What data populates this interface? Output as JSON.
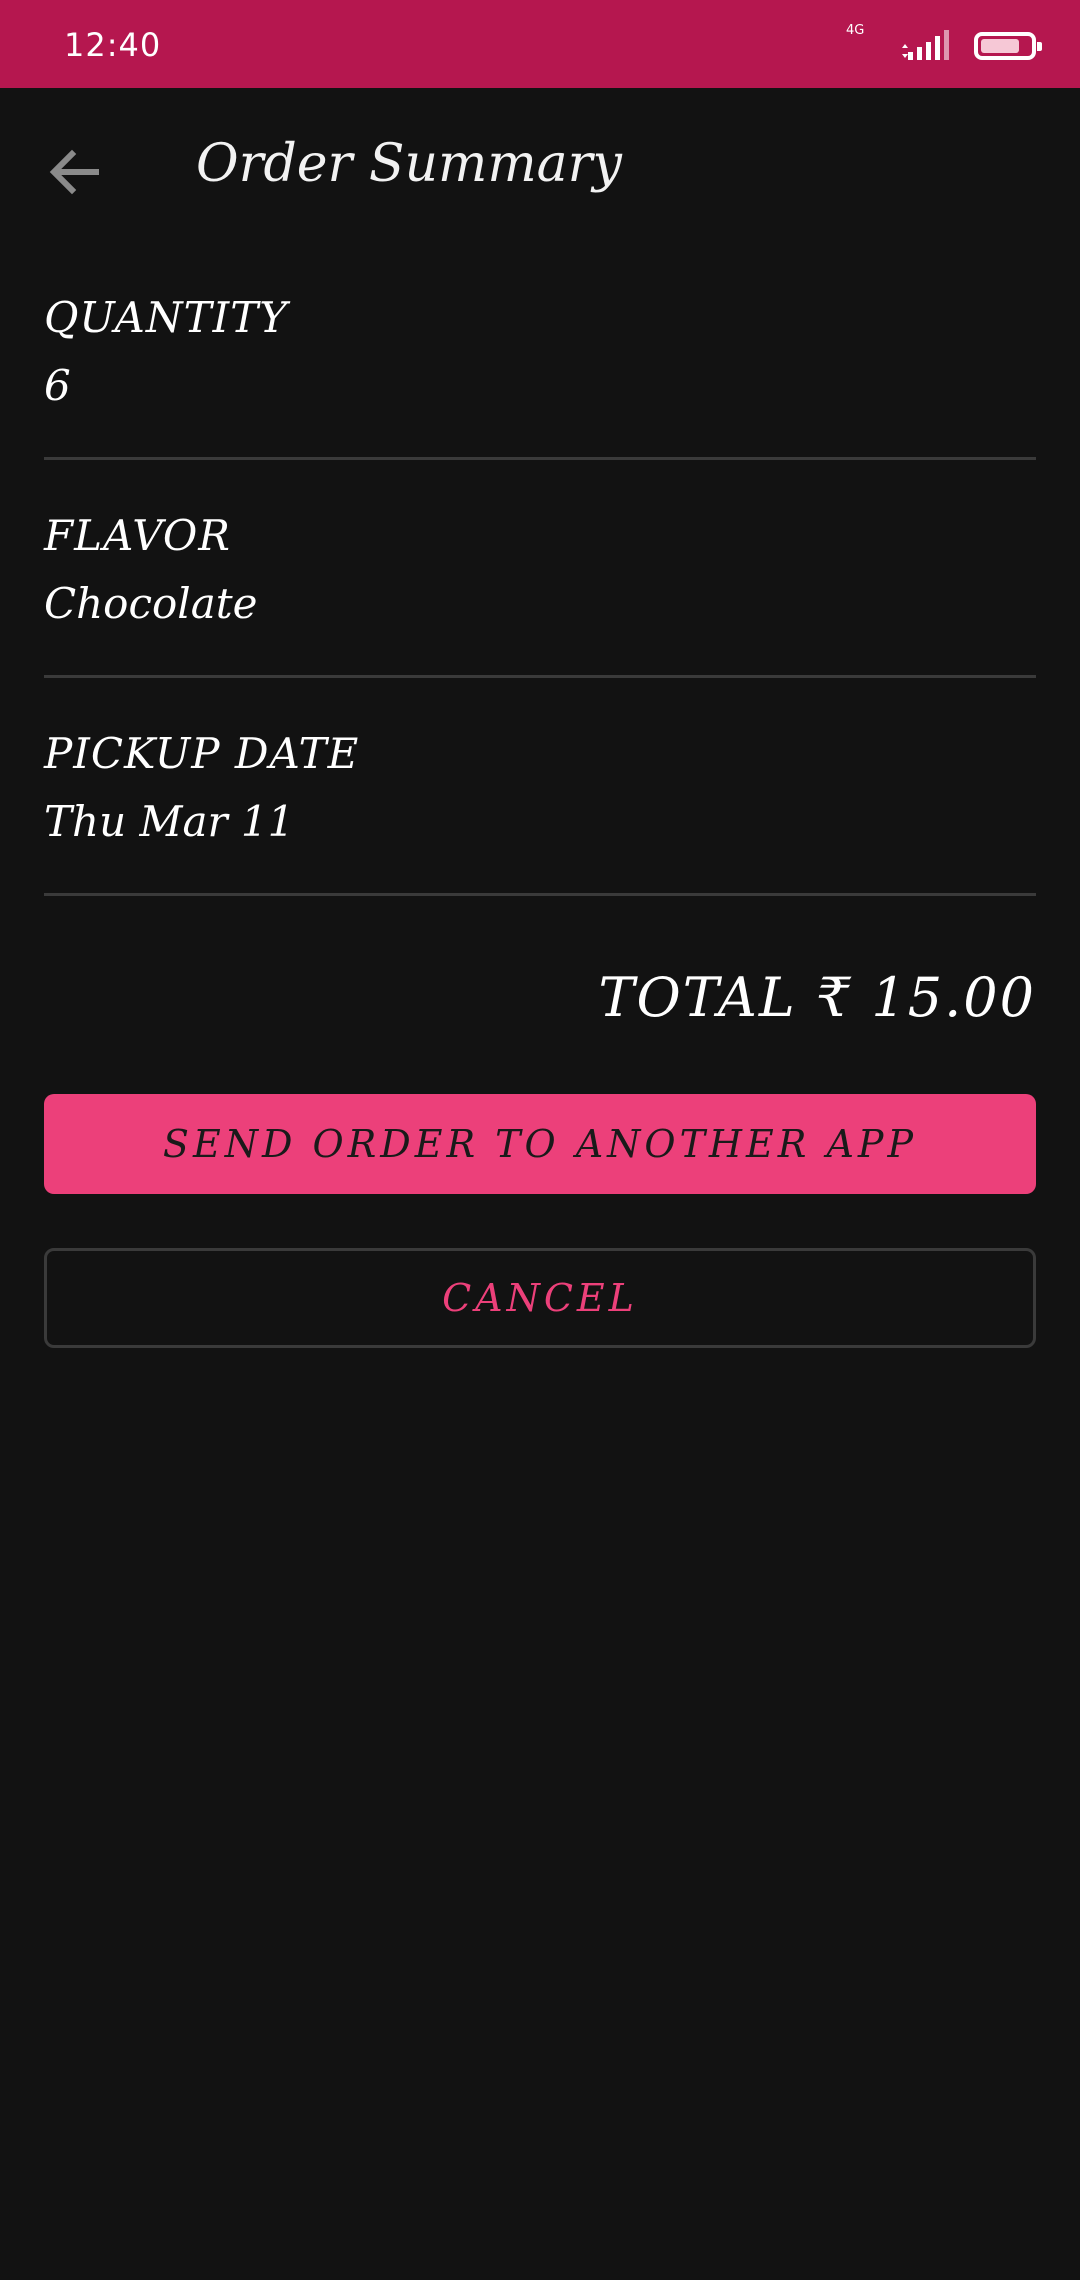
{
  "status_bar": {
    "time": "12:40",
    "network": "4G",
    "signal_icon": "signal-icon",
    "battery_icon": "battery-icon",
    "battery_level": 0.8,
    "color": "#b5174f"
  },
  "app_bar": {
    "back_icon": "arrow-left-icon",
    "title": "Order Summary"
  },
  "summary": {
    "quantity": {
      "label": "QUANTITY",
      "value": "6"
    },
    "flavor": {
      "label": "FLAVOR",
      "value": "Chocolate"
    },
    "pickup_date": {
      "label": "PICKUP DATE",
      "value": "Thu Mar 11"
    }
  },
  "total": "TOTAL ₹ 15.00",
  "actions": {
    "send_label": "SEND ORDER TO ANOTHER APP",
    "cancel_label": "CANCEL"
  },
  "colors": {
    "accent": "#ec407a",
    "background": "#121212",
    "divider": "#3a3a3a"
  }
}
